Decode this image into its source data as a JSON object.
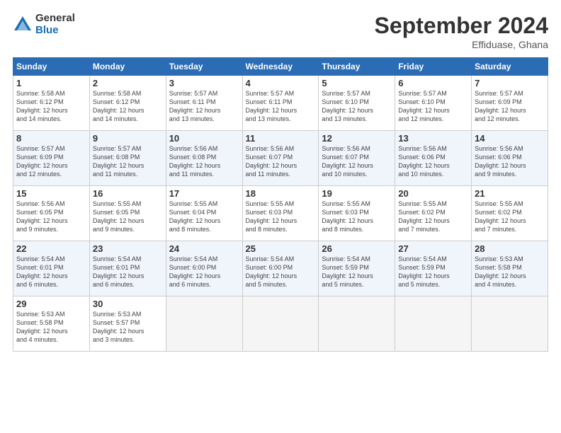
{
  "header": {
    "logo_general": "General",
    "logo_blue": "Blue",
    "title": "September 2024",
    "location": "Effiduase, Ghana"
  },
  "columns": [
    "Sunday",
    "Monday",
    "Tuesday",
    "Wednesday",
    "Thursday",
    "Friday",
    "Saturday"
  ],
  "weeks": [
    [
      {
        "day": "1",
        "info": "Sunrise: 5:58 AM\nSunset: 6:12 PM\nDaylight: 12 hours\nand 14 minutes."
      },
      {
        "day": "2",
        "info": "Sunrise: 5:58 AM\nSunset: 6:12 PM\nDaylight: 12 hours\nand 14 minutes."
      },
      {
        "day": "3",
        "info": "Sunrise: 5:57 AM\nSunset: 6:11 PM\nDaylight: 12 hours\nand 13 minutes."
      },
      {
        "day": "4",
        "info": "Sunrise: 5:57 AM\nSunset: 6:11 PM\nDaylight: 12 hours\nand 13 minutes."
      },
      {
        "day": "5",
        "info": "Sunrise: 5:57 AM\nSunset: 6:10 PM\nDaylight: 12 hours\nand 13 minutes."
      },
      {
        "day": "6",
        "info": "Sunrise: 5:57 AM\nSunset: 6:10 PM\nDaylight: 12 hours\nand 12 minutes."
      },
      {
        "day": "7",
        "info": "Sunrise: 5:57 AM\nSunset: 6:09 PM\nDaylight: 12 hours\nand 12 minutes."
      }
    ],
    [
      {
        "day": "8",
        "info": "Sunrise: 5:57 AM\nSunset: 6:09 PM\nDaylight: 12 hours\nand 12 minutes."
      },
      {
        "day": "9",
        "info": "Sunrise: 5:57 AM\nSunset: 6:08 PM\nDaylight: 12 hours\nand 11 minutes."
      },
      {
        "day": "10",
        "info": "Sunrise: 5:56 AM\nSunset: 6:08 PM\nDaylight: 12 hours\nand 11 minutes."
      },
      {
        "day": "11",
        "info": "Sunrise: 5:56 AM\nSunset: 6:07 PM\nDaylight: 12 hours\nand 11 minutes."
      },
      {
        "day": "12",
        "info": "Sunrise: 5:56 AM\nSunset: 6:07 PM\nDaylight: 12 hours\nand 10 minutes."
      },
      {
        "day": "13",
        "info": "Sunrise: 5:56 AM\nSunset: 6:06 PM\nDaylight: 12 hours\nand 10 minutes."
      },
      {
        "day": "14",
        "info": "Sunrise: 5:56 AM\nSunset: 6:06 PM\nDaylight: 12 hours\nand 9 minutes."
      }
    ],
    [
      {
        "day": "15",
        "info": "Sunrise: 5:56 AM\nSunset: 6:05 PM\nDaylight: 12 hours\nand 9 minutes."
      },
      {
        "day": "16",
        "info": "Sunrise: 5:55 AM\nSunset: 6:05 PM\nDaylight: 12 hours\nand 9 minutes."
      },
      {
        "day": "17",
        "info": "Sunrise: 5:55 AM\nSunset: 6:04 PM\nDaylight: 12 hours\nand 8 minutes."
      },
      {
        "day": "18",
        "info": "Sunrise: 5:55 AM\nSunset: 6:03 PM\nDaylight: 12 hours\nand 8 minutes."
      },
      {
        "day": "19",
        "info": "Sunrise: 5:55 AM\nSunset: 6:03 PM\nDaylight: 12 hours\nand 8 minutes."
      },
      {
        "day": "20",
        "info": "Sunrise: 5:55 AM\nSunset: 6:02 PM\nDaylight: 12 hours\nand 7 minutes."
      },
      {
        "day": "21",
        "info": "Sunrise: 5:55 AM\nSunset: 6:02 PM\nDaylight: 12 hours\nand 7 minutes."
      }
    ],
    [
      {
        "day": "22",
        "info": "Sunrise: 5:54 AM\nSunset: 6:01 PM\nDaylight: 12 hours\nand 6 minutes."
      },
      {
        "day": "23",
        "info": "Sunrise: 5:54 AM\nSunset: 6:01 PM\nDaylight: 12 hours\nand 6 minutes."
      },
      {
        "day": "24",
        "info": "Sunrise: 5:54 AM\nSunset: 6:00 PM\nDaylight: 12 hours\nand 6 minutes."
      },
      {
        "day": "25",
        "info": "Sunrise: 5:54 AM\nSunset: 6:00 PM\nDaylight: 12 hours\nand 5 minutes."
      },
      {
        "day": "26",
        "info": "Sunrise: 5:54 AM\nSunset: 5:59 PM\nDaylight: 12 hours\nand 5 minutes."
      },
      {
        "day": "27",
        "info": "Sunrise: 5:54 AM\nSunset: 5:59 PM\nDaylight: 12 hours\nand 5 minutes."
      },
      {
        "day": "28",
        "info": "Sunrise: 5:53 AM\nSunset: 5:58 PM\nDaylight: 12 hours\nand 4 minutes."
      }
    ],
    [
      {
        "day": "29",
        "info": "Sunrise: 5:53 AM\nSunset: 5:58 PM\nDaylight: 12 hours\nand 4 minutes."
      },
      {
        "day": "30",
        "info": "Sunrise: 5:53 AM\nSunset: 5:57 PM\nDaylight: 12 hours\nand 3 minutes."
      },
      {
        "day": "",
        "info": ""
      },
      {
        "day": "",
        "info": ""
      },
      {
        "day": "",
        "info": ""
      },
      {
        "day": "",
        "info": ""
      },
      {
        "day": "",
        "info": ""
      }
    ]
  ]
}
